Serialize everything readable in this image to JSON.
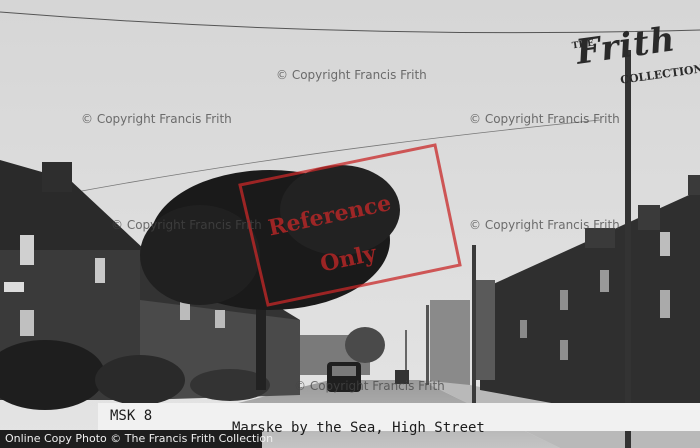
{
  "watermarks": {
    "copyright": "© Copyright Francis Frith"
  },
  "stamp": {
    "line1": "Reference",
    "line2": "Only"
  },
  "logo": {
    "the": "THE",
    "main": "Frith",
    "sub": "COLLECTION"
  },
  "caption": {
    "code": "MSK 8",
    "title": "Marske by the Sea, High Street"
  },
  "credit": {
    "text": "Online Copy Photo © The Francis Frith Collection"
  },
  "colors": {
    "stamp_red": "#c82828",
    "credit_bar": "#1e1e1e"
  }
}
